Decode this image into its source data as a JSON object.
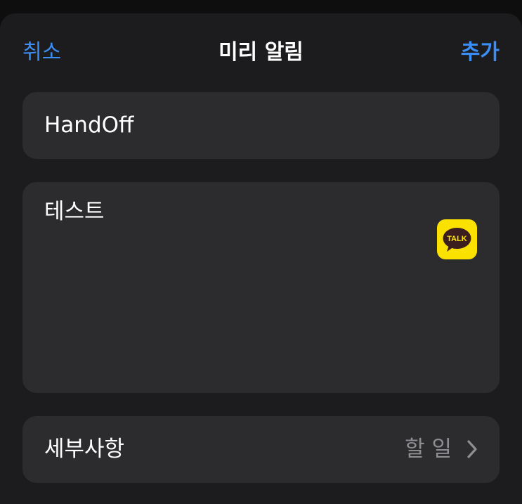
{
  "nav": {
    "cancel_label": "취소",
    "title": "미리 알림",
    "add_label": "추가"
  },
  "reminder": {
    "title_value": "HandOff",
    "notes_value": "테스트",
    "app_icon": "kakaotalk-icon",
    "app_icon_text": "TALK"
  },
  "details": {
    "label": "세부사항",
    "value": "할 일"
  },
  "colors": {
    "accent": "#3a8ef6",
    "sheet_background": "#1c1c1e",
    "card_background": "#2c2c2e",
    "secondary_text": "#8e8e93",
    "kakao_yellow": "#fae100",
    "kakao_brown": "#3c1e1e"
  }
}
